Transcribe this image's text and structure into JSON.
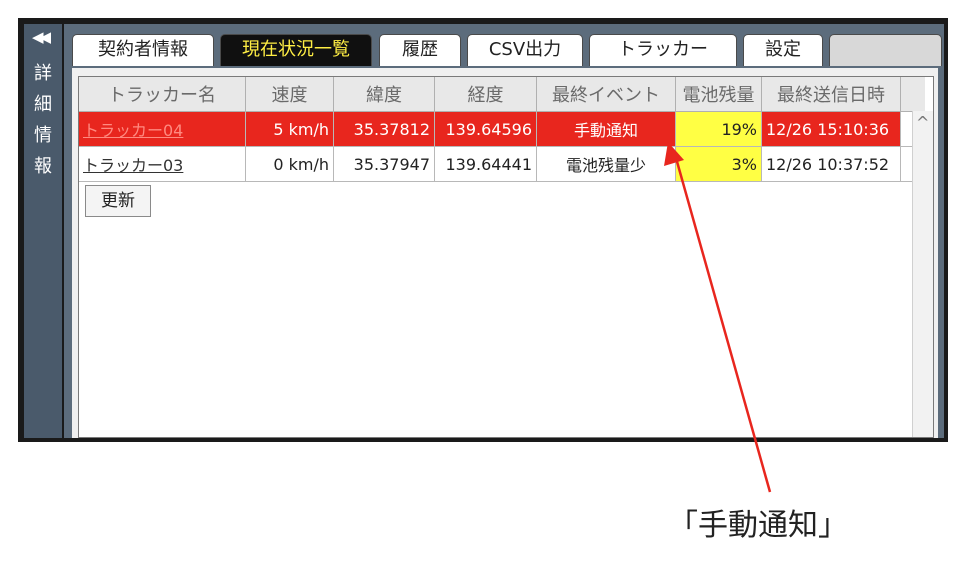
{
  "sidebar": {
    "collapse_icon": "double-chevron-left-icon",
    "label": "詳細情報"
  },
  "tabs": [
    {
      "label": "契約者情報",
      "active": false
    },
    {
      "label": "現在状況一覧",
      "active": true
    },
    {
      "label": "履歴",
      "active": false
    },
    {
      "label": "CSV出力",
      "active": false
    },
    {
      "label": "トラッカー",
      "active": false
    },
    {
      "label": "設定",
      "active": false
    }
  ],
  "table": {
    "headers": [
      "トラッカー名",
      "速度",
      "緯度",
      "経度",
      "最終イベント",
      "電池残量",
      "最終送信日時"
    ],
    "rows": [
      {
        "name": "トラッカー04",
        "speed": "5 km/h",
        "lat": "35.37812",
        "lon": "139.64596",
        "event": "手動通知",
        "battery": "19%",
        "sent": "12/26 15:10:36"
      },
      {
        "name": "トラッカー03",
        "speed": "0 km/h",
        "lat": "35.37947",
        "lon": "139.64441",
        "event": "電池残量少",
        "battery": "3%",
        "sent": "12/26 10:37:52"
      }
    ]
  },
  "refresh_label": "更新",
  "annotation": {
    "caption": "「手動通知」"
  },
  "colors": {
    "alert_row": "#e8261e",
    "battery_highlight": "#ffff44",
    "active_tab_text": "#ffee44",
    "arrow": "#e8261e"
  }
}
